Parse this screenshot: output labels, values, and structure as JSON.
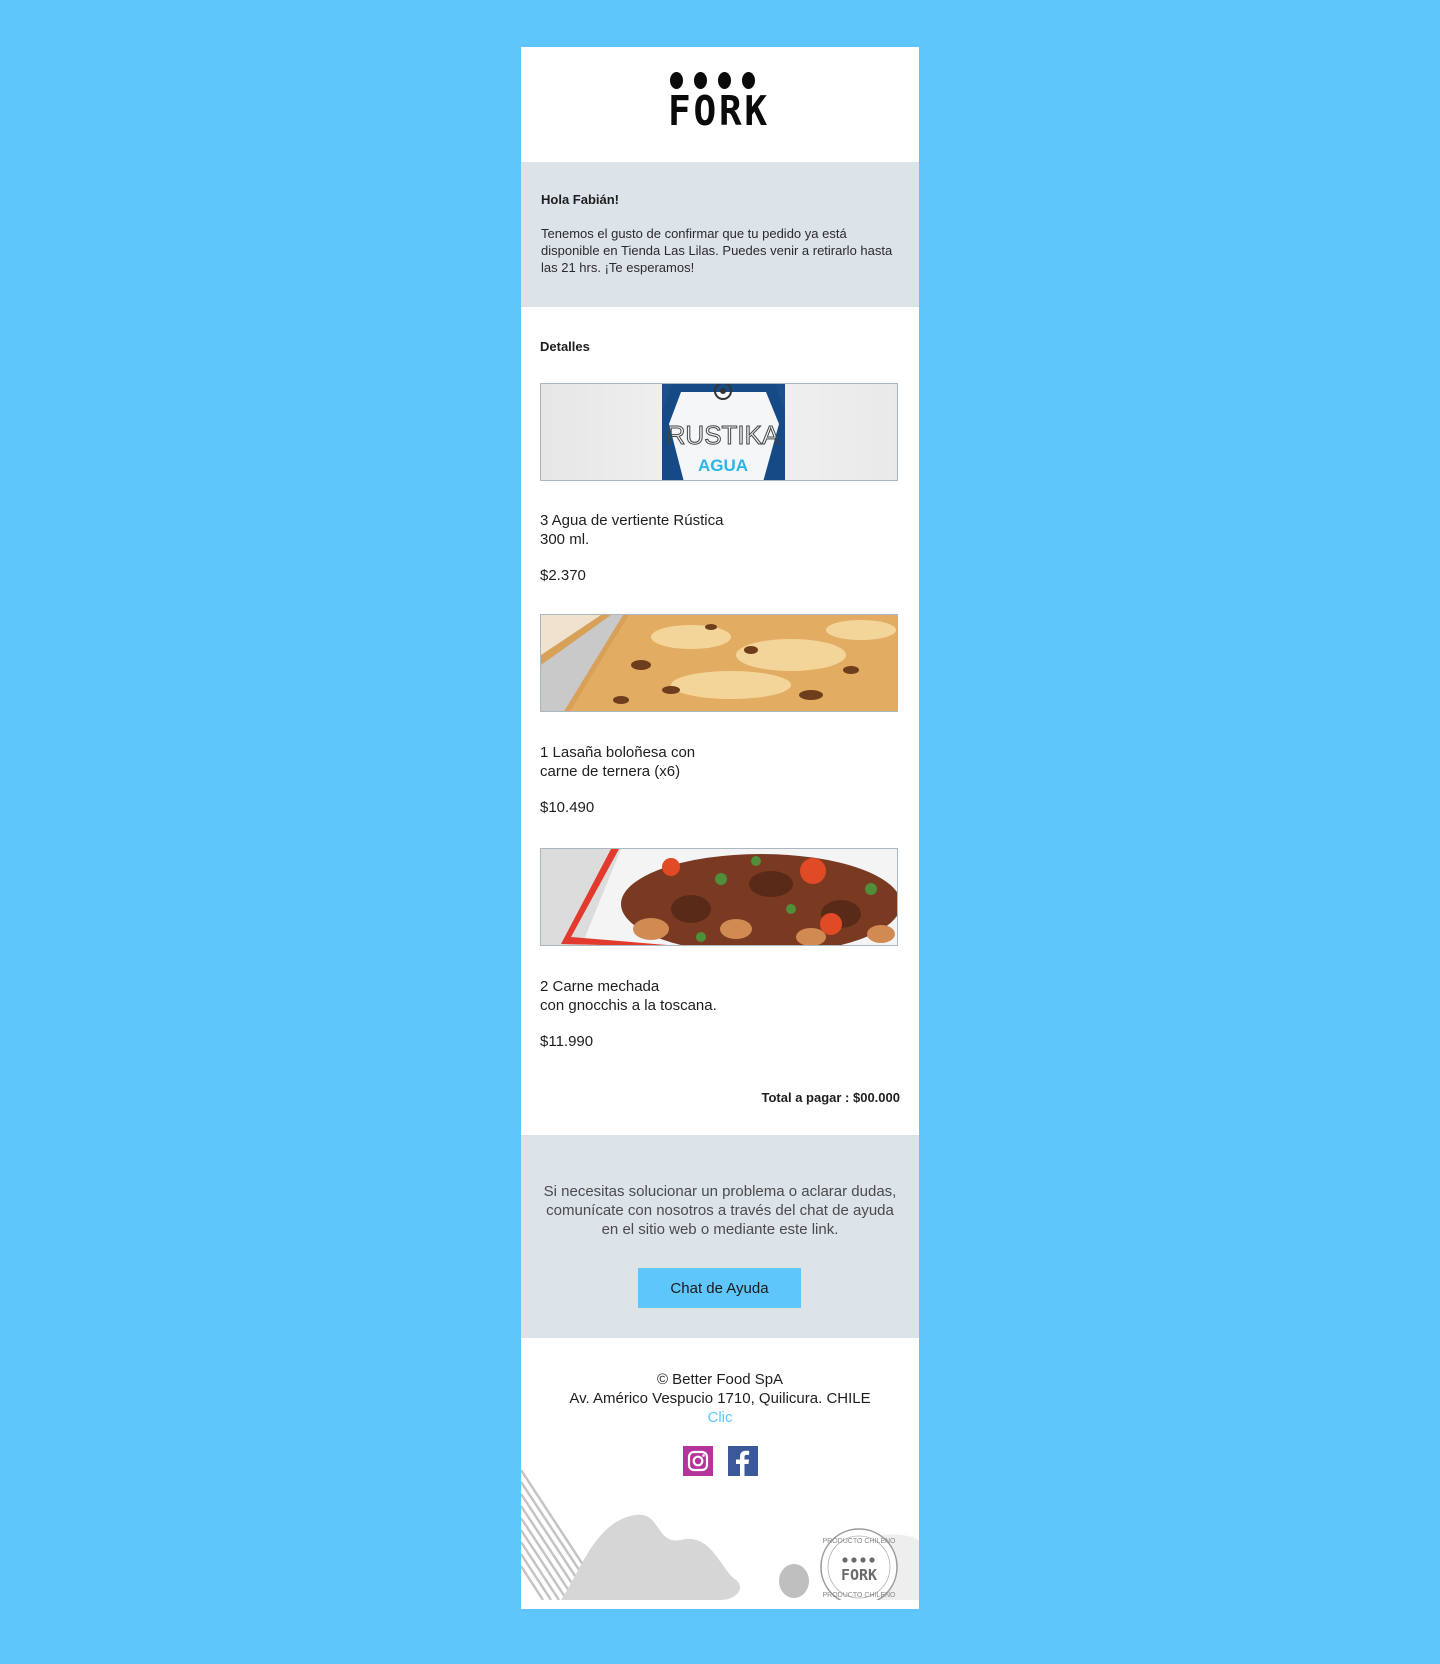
{
  "brand": {
    "logo_text": "FORK"
  },
  "greeting": {
    "title": "Hola Fabián!",
    "body": "Tenemos el gusto de confirmar que tu pedido ya está disponible en Tienda Las Lilas. Puedes venir a retirarlo hasta las 21 hrs.  ¡Te esperamos!"
  },
  "details": {
    "title": "Detalles",
    "items": [
      {
        "name": "3 Agua de vertiente Rústica\n300 ml.",
        "price": "$2.370",
        "image": "water-bottle-image",
        "image_label": "RUSTIKA",
        "image_sublabel": "AGUA"
      },
      {
        "name": "1 Lasaña boloñesa con\ncarne de ternera (x6)",
        "price": "$10.490",
        "image": "lasagna-image"
      },
      {
        "name": "2 Carne mechada\ncon gnocchis a la toscana.",
        "price": "$11.990",
        "image": "beef-gnocchi-image"
      }
    ],
    "total": "Total a pagar : $00.000"
  },
  "help": {
    "text": "Si necesitas solucionar un problema o aclarar dudas, comunícate con nosotros a través del chat de ayuda en el sitio web o mediante este link.",
    "button_label": "Chat de Ayuda"
  },
  "footer": {
    "copyright": "© Better Food SpA",
    "address": "Av. Américo Vespucio 1710, Quilicura. CHILE",
    "link_label": "Clic",
    "socials": [
      "instagram-icon",
      "facebook-icon"
    ],
    "stamp_text": "PRODUCTO CHILENO",
    "stamp_logo": "FORK"
  },
  "colors": {
    "background": "#5ec6fa",
    "panel": "#dce3e9",
    "accent": "#5ec6fa",
    "instagram": "#b4339c",
    "facebook": "#3b5998"
  }
}
